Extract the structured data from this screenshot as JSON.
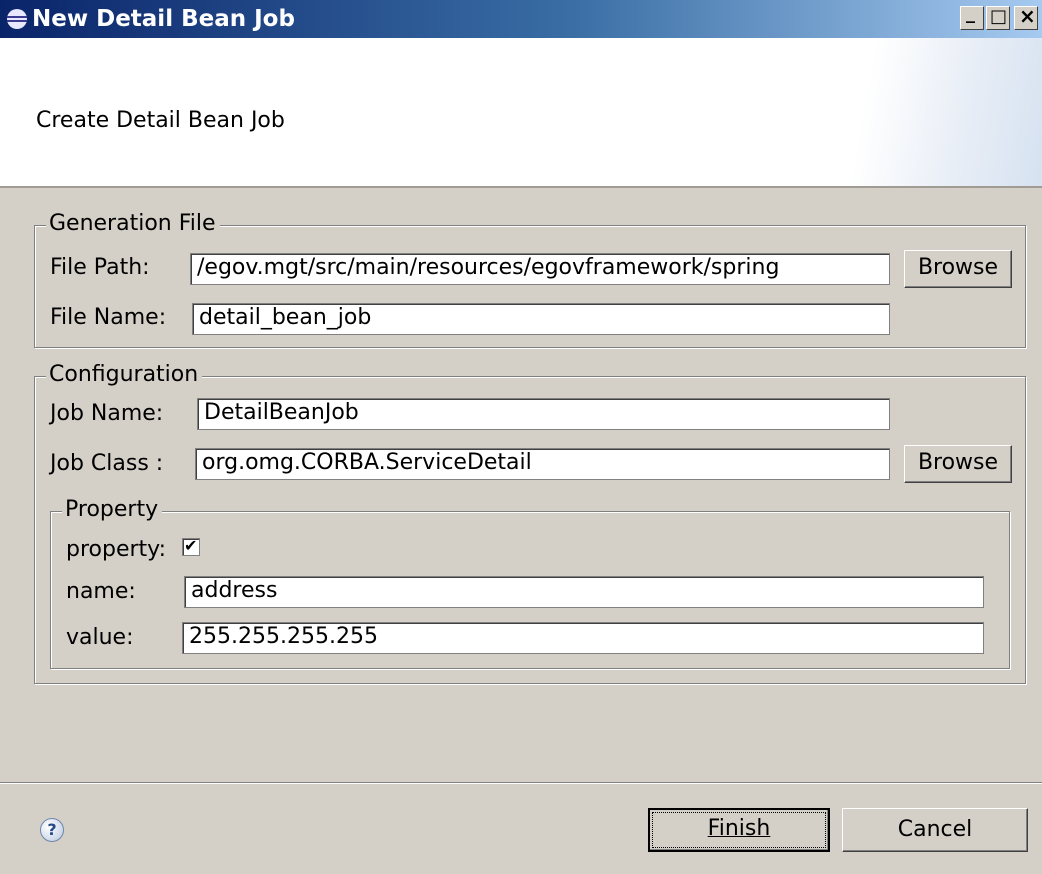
{
  "window": {
    "title": "New Detail Bean Job",
    "min_glyph": "_",
    "max_glyph": "□",
    "close_glyph": "×"
  },
  "header": {
    "description": "Create Detail Bean Job"
  },
  "generation_file": {
    "legend": "Generation File",
    "file_path_label": "File Path:",
    "file_path_value": "/egov.mgt/src/main/resources/egovframework/spring",
    "browse_label": "Browse",
    "file_name_label": "File Name:",
    "file_name_value": "detail_bean_job"
  },
  "configuration": {
    "legend": "Configuration",
    "job_name_label": "Job Name:",
    "job_name_value": "DetailBeanJob",
    "job_class_label": "Job Class :",
    "job_class_value": "org.omg.CORBA.ServiceDetail",
    "browse_label": "Browse",
    "property": {
      "legend": "Property",
      "property_label": "property:",
      "property_checked": true,
      "check_glyph": "✔",
      "name_label": "name:",
      "name_value": "address",
      "value_label": "value:",
      "value_value": "255.255.255.255"
    }
  },
  "footer": {
    "help_glyph": "?",
    "finish_label": "Finish",
    "cancel_label": "Cancel"
  }
}
